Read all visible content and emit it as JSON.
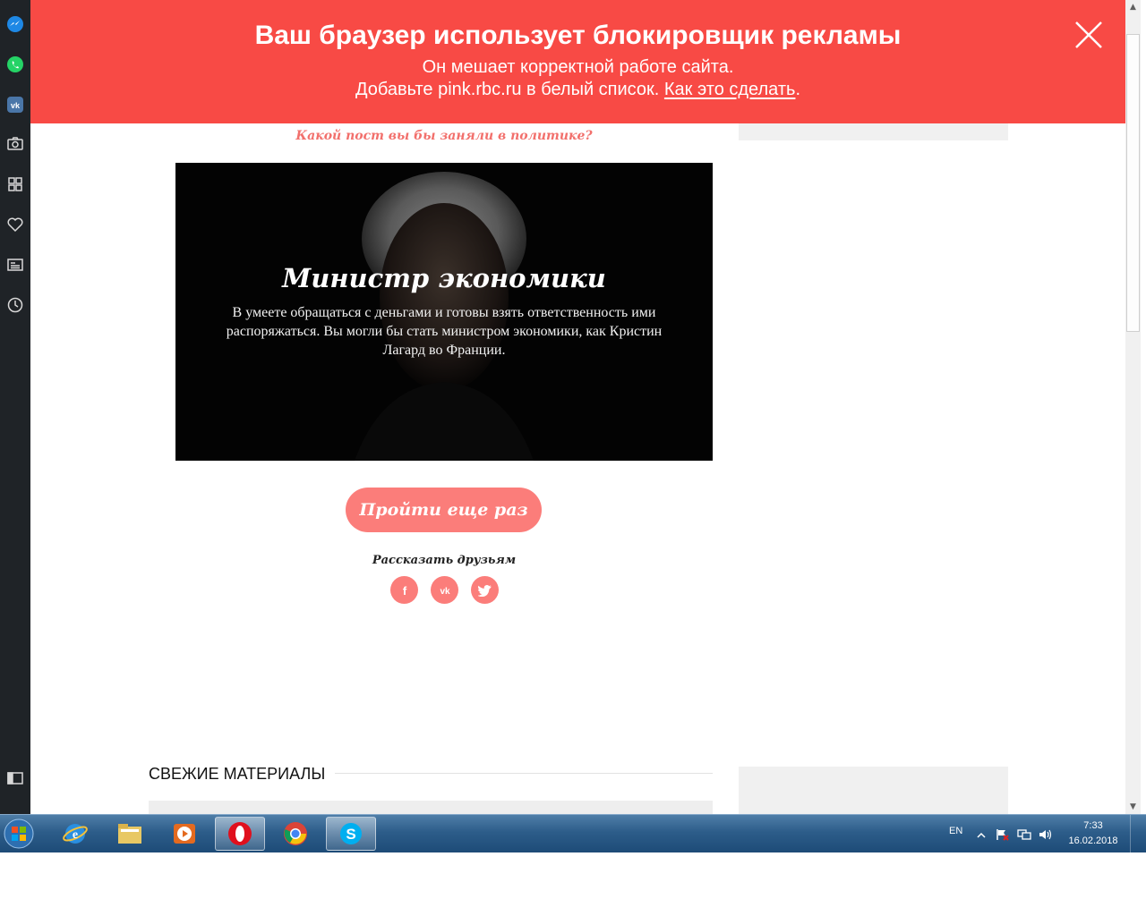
{
  "sidebar": {
    "items": [
      {
        "icon": "messenger-icon",
        "color": "#1e88e5"
      },
      {
        "icon": "whatsapp-icon",
        "color": "#25d366"
      },
      {
        "icon": "vk-icon",
        "color": "#4a76a8"
      },
      {
        "icon": "camera-icon"
      },
      {
        "icon": "speed-dial-icon"
      },
      {
        "icon": "heart-icon"
      },
      {
        "icon": "news-icon"
      },
      {
        "icon": "history-icon"
      },
      {
        "icon": "sidebar-toggle-icon"
      }
    ]
  },
  "banner": {
    "title": "Ваш браузер использует блокировщик рекламы",
    "line1": "Он мешает корректной работе сайта.",
    "line2_prefix": "Добавьте pink.rbc.ru в белый список. ",
    "link": "Как это сделать",
    "line2_suffix": ".",
    "color": "#f84a45"
  },
  "quiz": {
    "question": "Какой пост вы бы заняли в политике?",
    "result_title": "Министр экономики",
    "result_text": "В умеете обращаться с деньгами и готовы взять ответственность ими распоряжаться. Вы могли бы стать министром экономики, как Кристин Лагард во Франции.",
    "retry_label": "Пройти еще раз",
    "share_label": "Рассказать друзьям",
    "share": [
      "facebook-icon",
      "vk-icon",
      "twitter-icon"
    ],
    "accent": "#fb7d7a"
  },
  "fresh": {
    "title": "СВЕЖИЕ МАТЕРИАЛЫ"
  },
  "taskbar": {
    "apps": [
      "internet-explorer-icon",
      "file-explorer-icon",
      "media-player-icon",
      "opera-icon",
      "chrome-icon",
      "skype-icon"
    ],
    "lang": "EN",
    "time": "7:33",
    "date": "16.02.2018"
  }
}
